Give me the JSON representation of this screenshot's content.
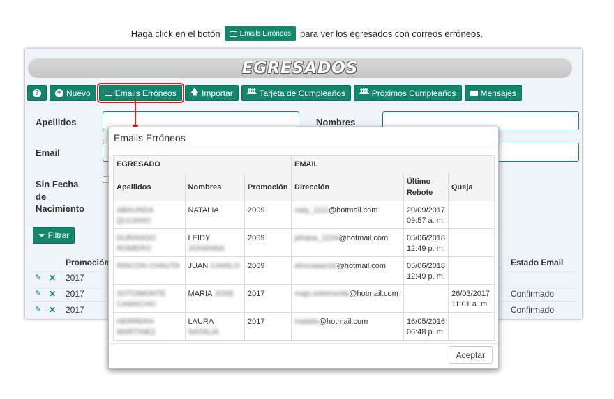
{
  "instruction": {
    "before": "Haga click en el botón",
    "button_label": "Emails Erróneos",
    "after": "para ver los egresados con correos erróneos."
  },
  "app": {
    "title": "EGRESADOS",
    "toolbar": {
      "nuevo": "Nuevo",
      "emails_erroneos": "Emails Erróneos",
      "importar": "Importar",
      "tarjeta": "Tarjeta de Cumpleaños",
      "proximos": "Próximos Cumpleaños",
      "mensajes": "Mensajes"
    },
    "filters": {
      "apellidos": "Apellidos",
      "nombres": "Nombres",
      "email": "Email",
      "sin_fecha_1": "Sin Fecha",
      "sin_fecha_2": "de",
      "sin_fecha_3": "Nacimiento",
      "filtrar": "Filtrar"
    },
    "table": {
      "promocion_header": "Promoción",
      "estado_header": "Estado Email",
      "rows": [
        {
          "promocion": "2017",
          "estado": ""
        },
        {
          "promocion": "2017",
          "estado": "Confirmado"
        },
        {
          "promocion": "2017",
          "estado": "Confirmado"
        }
      ]
    }
  },
  "modal": {
    "title": "Emails Erróneos",
    "group_egresado": "EGRESADO",
    "group_email": "EMAIL",
    "col_apellidos": "Apellidos",
    "col_nombres": "Nombres",
    "col_promocion": "Promoción",
    "col_direccion": "Dirección",
    "col_rebote_1": "Último",
    "col_rebote_2": "Rebote",
    "col_queja": "Queja",
    "rows": [
      {
        "ap1": "ABAUNDA",
        "ap2": "QUIJANO",
        "n1": "NATALIA",
        "n2": "",
        "promocion": "2009",
        "email_user": "naty_1111",
        "email_domain": "@hotmail.com",
        "rebote_date": "20/09/2017",
        "rebote_time": "09:57 a. m.",
        "queja_date": "",
        "queja_time": ""
      },
      {
        "ap1": "DURANGO",
        "ap2": "ROMERO",
        "n1": "LEIDY",
        "n2": "JOHANNA",
        "promocion": "2009",
        "email_user": "johana_1234",
        "email_domain": "@hotmail.com",
        "rebote_date": "05/06/2018",
        "rebote_time": "12:49 p. m.",
        "queja_date": "",
        "queja_time": ""
      },
      {
        "ap1": "RINCON CHAUTA",
        "ap2": "",
        "n1": "JUAN",
        "n2": "CAMILO",
        "promocion": "2009",
        "email_user": "elrocaaao16",
        "email_domain": "@hotmail.com",
        "rebote_date": "05/06/2018",
        "rebote_time": "12:49 p. m.",
        "queja_date": "",
        "queja_time": ""
      },
      {
        "ap1": "SOTOMONTE",
        "ap2": "CAMACHO",
        "n1": "MARIA",
        "n2": "JOSE",
        "promocion": "2017",
        "email_user": "majo.sotomonte",
        "email_domain": "@hotmail.com",
        "rebote_date": "",
        "rebote_time": "",
        "queja_date": "26/03/2017",
        "queja_time": "11:01 a. m."
      },
      {
        "ap1": "HERRERA",
        "ap2": "MARTINEZ",
        "n1": "LAURA",
        "n2": "NATALIA",
        "promocion": "2017",
        "email_user": "lnatalia",
        "email_domain": "@hotmail.com",
        "rebote_date": "16/05/2016",
        "rebote_time": "06:48 p. m.",
        "queja_date": "",
        "queja_time": ""
      }
    ],
    "aceptar": "Aceptar"
  }
}
